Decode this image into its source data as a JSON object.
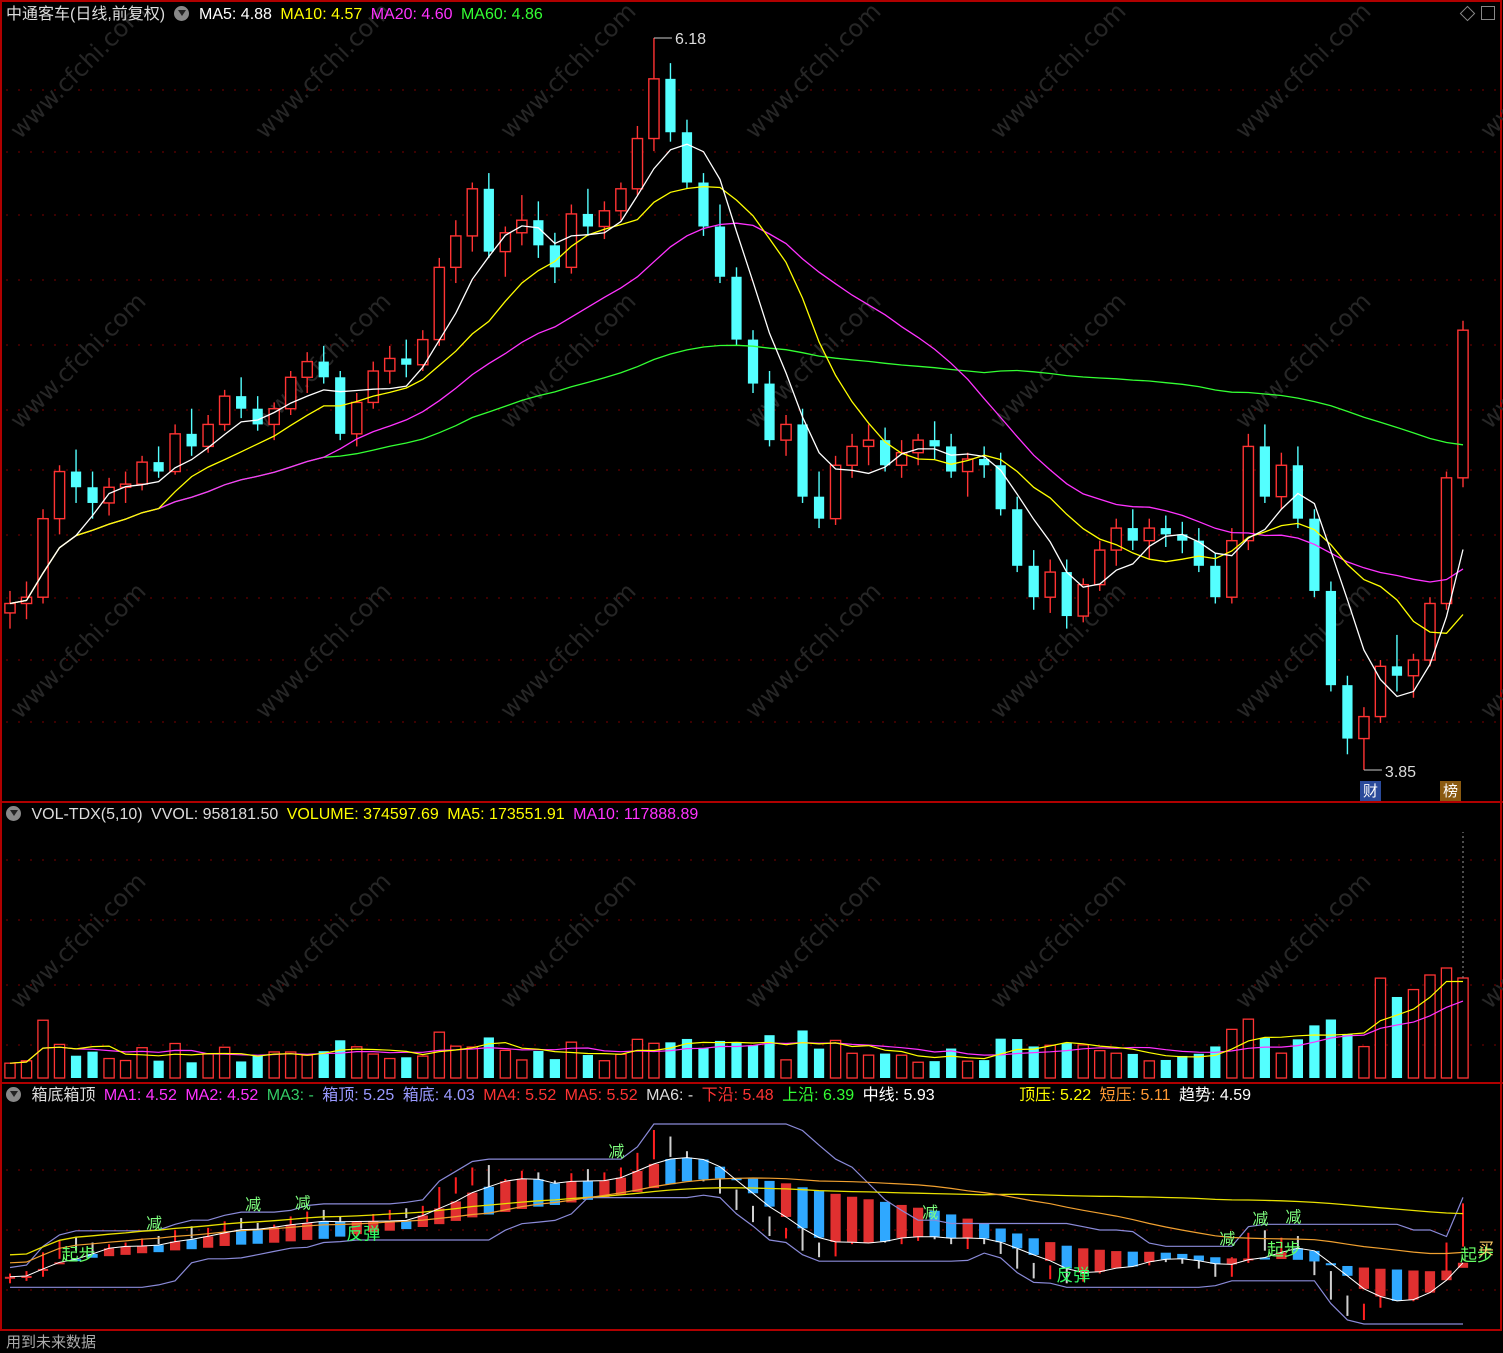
{
  "main_panel": {
    "title": "中通客车(日线,前复权)",
    "indicators": [
      {
        "label": "MA5: 4.88",
        "color": "#ffffff"
      },
      {
        "label": "MA10: 4.57",
        "color": "#ffff00"
      },
      {
        "label": "MA20: 4.60",
        "color": "#ff33ff"
      },
      {
        "label": "MA60: 4.86",
        "color": "#33ff33"
      }
    ],
    "high_label": "6.18",
    "low_label": "3.85",
    "tag_cai": "财",
    "tag_bang": "榜"
  },
  "vol_panel": {
    "title": "VOL-TDX(5,10)",
    "indicators": [
      {
        "label": "VVOL: 958181.50",
        "color": "#dddddd"
      },
      {
        "label": "VOLUME: 374597.69",
        "color": "#ffff00"
      },
      {
        "label": "MA5: 173551.91",
        "color": "#ffff00"
      },
      {
        "label": "MA10: 117888.89",
        "color": "#ff33ff"
      }
    ]
  },
  "box_panel": {
    "title": "箱底箱顶",
    "indicators": [
      {
        "label": "MA1: 4.52",
        "color": "#ff33ff"
      },
      {
        "label": "MA2: 4.52",
        "color": "#ff33ff"
      },
      {
        "label": "MA3: -",
        "color": "#33cc66"
      },
      {
        "label": "箱顶: 5.25",
        "color": "#9999ff"
      },
      {
        "label": "箱底: 4.03",
        "color": "#9999ff"
      },
      {
        "label": "MA4: 5.52",
        "color": "#ff3333"
      },
      {
        "label": "MA5: 5.52",
        "color": "#ff3333"
      },
      {
        "label": "MA6: -",
        "color": "#dddddd"
      },
      {
        "label": "下沿: 5.48",
        "color": "#ff3333"
      },
      {
        "label": "上沿: 6.39",
        "color": "#33ff33"
      },
      {
        "label": "中线: 5.93",
        "color": "#ffffff"
      },
      {
        "label": "顶压: 5.22",
        "color": "#ffff00"
      },
      {
        "label": "短压: 5.11",
        "color": "#ff9933"
      },
      {
        "label": "趋势: 4.59",
        "color": "#ffffff"
      }
    ],
    "signals": {
      "jian": "减",
      "fantan": "反弹",
      "qibu": "起步",
      "mai": "买"
    }
  },
  "footer": "用到未来数据",
  "watermark": "www.cfchi.com",
  "colors": {
    "up": "#ff3333",
    "down": "#54ffff",
    "ma5": "#ffffff",
    "ma10": "#ffff00",
    "ma20": "#ff33ff",
    "ma60": "#33ff33",
    "frame": "#b00000"
  },
  "chart_data": [
    {
      "type": "candlestick",
      "title": "中通客车(日线,前复权)",
      "y_range": [
        3.85,
        6.18
      ],
      "candles_ohlc": [
        [
          4.35,
          4.42,
          4.3,
          4.38
        ],
        [
          4.38,
          4.45,
          4.33,
          4.4
        ],
        [
          4.4,
          4.68,
          4.38,
          4.65
        ],
        [
          4.65,
          4.82,
          4.6,
          4.8
        ],
        [
          4.8,
          4.87,
          4.7,
          4.75
        ],
        [
          4.75,
          4.8,
          4.65,
          4.7
        ],
        [
          4.7,
          4.78,
          4.66,
          4.75
        ],
        [
          4.75,
          4.8,
          4.7,
          4.76
        ],
        [
          4.76,
          4.85,
          4.74,
          4.83
        ],
        [
          4.83,
          4.88,
          4.78,
          4.8
        ],
        [
          4.8,
          4.95,
          4.79,
          4.92
        ],
        [
          4.92,
          5.0,
          4.85,
          4.88
        ],
        [
          4.88,
          4.98,
          4.86,
          4.95
        ],
        [
          4.95,
          5.06,
          4.93,
          5.04
        ],
        [
          5.04,
          5.1,
          4.97,
          5.0
        ],
        [
          5.0,
          5.04,
          4.93,
          4.95
        ],
        [
          4.95,
          5.02,
          4.9,
          5.0
        ],
        [
          5.0,
          5.12,
          4.98,
          5.1
        ],
        [
          5.1,
          5.18,
          5.05,
          5.15
        ],
        [
          5.15,
          5.2,
          5.08,
          5.1
        ],
        [
          5.1,
          5.12,
          4.9,
          4.92
        ],
        [
          4.92,
          5.05,
          4.88,
          5.02
        ],
        [
          5.02,
          5.15,
          5.0,
          5.12
        ],
        [
          5.12,
          5.2,
          5.08,
          5.16
        ],
        [
          5.16,
          5.22,
          5.1,
          5.14
        ],
        [
          5.14,
          5.25,
          5.12,
          5.22
        ],
        [
          5.22,
          5.48,
          5.2,
          5.45
        ],
        [
          5.45,
          5.6,
          5.4,
          5.55
        ],
        [
          5.55,
          5.72,
          5.5,
          5.7
        ],
        [
          5.7,
          5.75,
          5.48,
          5.5
        ],
        [
          5.5,
          5.58,
          5.42,
          5.56
        ],
        [
          5.56,
          5.68,
          5.52,
          5.6
        ],
        [
          5.6,
          5.66,
          5.48,
          5.52
        ],
        [
          5.52,
          5.56,
          5.4,
          5.45
        ],
        [
          5.45,
          5.65,
          5.43,
          5.62
        ],
        [
          5.62,
          5.7,
          5.55,
          5.58
        ],
        [
          5.58,
          5.66,
          5.54,
          5.63
        ],
        [
          5.63,
          5.72,
          5.6,
          5.7
        ],
        [
          5.7,
          5.9,
          5.68,
          5.86
        ],
        [
          5.86,
          6.18,
          5.82,
          6.05
        ],
        [
          6.05,
          6.1,
          5.85,
          5.88
        ],
        [
          5.88,
          5.92,
          5.7,
          5.72
        ],
        [
          5.72,
          5.75,
          5.55,
          5.58
        ],
        [
          5.58,
          5.65,
          5.4,
          5.42
        ],
        [
          5.42,
          5.45,
          5.2,
          5.22
        ],
        [
          5.22,
          5.25,
          5.05,
          5.08
        ],
        [
          5.08,
          5.12,
          4.88,
          4.9
        ],
        [
          4.9,
          4.98,
          4.85,
          4.95
        ],
        [
          4.95,
          5.0,
          4.7,
          4.72
        ],
        [
          4.72,
          4.8,
          4.62,
          4.65
        ],
        [
          4.65,
          4.85,
          4.63,
          4.82
        ],
        [
          4.82,
          4.92,
          4.78,
          4.88
        ],
        [
          4.88,
          4.95,
          4.82,
          4.9
        ],
        [
          4.9,
          4.94,
          4.8,
          4.82
        ],
        [
          4.82,
          4.9,
          4.78,
          4.86
        ],
        [
          4.86,
          4.92,
          4.82,
          4.9
        ],
        [
          4.9,
          4.96,
          4.84,
          4.88
        ],
        [
          4.88,
          4.92,
          4.78,
          4.8
        ],
        [
          4.8,
          4.86,
          4.72,
          4.84
        ],
        [
          4.84,
          4.88,
          4.78,
          4.82
        ],
        [
          4.82,
          4.86,
          4.66,
          4.68
        ],
        [
          4.68,
          4.72,
          4.48,
          4.5
        ],
        [
          4.5,
          4.55,
          4.36,
          4.4
        ],
        [
          4.4,
          4.52,
          4.35,
          4.48
        ],
        [
          4.48,
          4.52,
          4.3,
          4.34
        ],
        [
          4.34,
          4.46,
          4.32,
          4.44
        ],
        [
          4.44,
          4.58,
          4.42,
          4.55
        ],
        [
          4.55,
          4.65,
          4.5,
          4.62
        ],
        [
          4.62,
          4.68,
          4.55,
          4.58
        ],
        [
          4.58,
          4.65,
          4.52,
          4.62
        ],
        [
          4.62,
          4.66,
          4.56,
          4.6
        ],
        [
          4.6,
          4.64,
          4.54,
          4.58
        ],
        [
          4.58,
          4.62,
          4.48,
          4.5
        ],
        [
          4.5,
          4.54,
          4.38,
          4.4
        ],
        [
          4.4,
          4.62,
          4.38,
          4.58
        ],
        [
          4.58,
          4.92,
          4.55,
          4.88
        ],
        [
          4.88,
          4.95,
          4.7,
          4.72
        ],
        [
          4.72,
          4.86,
          4.68,
          4.82
        ],
        [
          4.82,
          4.88,
          4.62,
          4.65
        ],
        [
          4.65,
          4.68,
          4.4,
          4.42
        ],
        [
          4.42,
          4.45,
          4.1,
          4.12
        ],
        [
          4.12,
          4.15,
          3.9,
          3.95
        ],
        [
          3.95,
          4.05,
          3.85,
          4.02
        ],
        [
          4.02,
          4.2,
          4.0,
          4.18
        ],
        [
          4.18,
          4.28,
          4.1,
          4.15
        ],
        [
          4.15,
          4.22,
          4.08,
          4.2
        ],
        [
          4.2,
          4.4,
          4.18,
          4.38
        ],
        [
          4.38,
          4.8,
          4.36,
          4.78
        ],
        [
          4.78,
          5.28,
          4.75,
          5.25
        ]
      ],
      "series": [
        {
          "name": "MA5",
          "current": 4.88
        },
        {
          "name": "MA10",
          "current": 4.57
        },
        {
          "name": "MA20",
          "current": 4.6
        },
        {
          "name": "MA60",
          "current": 4.86
        }
      ],
      "annotations": [
        {
          "text": "6.18",
          "kind": "high"
        },
        {
          "text": "3.85",
          "kind": "low"
        }
      ]
    },
    {
      "type": "bar",
      "title": "VOL-TDX(5,10)",
      "series": [
        {
          "name": "VVOL",
          "current": 958181.5
        },
        {
          "name": "VOLUME",
          "current": 374597.69
        },
        {
          "name": "MA5",
          "current": 173551.91
        },
        {
          "name": "MA10",
          "current": 117888.89
        }
      ]
    },
    {
      "type": "line",
      "title": "箱底箱顶",
      "series": [
        {
          "name": "MA1",
          "current": 4.52
        },
        {
          "name": "MA2",
          "current": 4.52
        },
        {
          "name": "箱顶",
          "current": 5.25
        },
        {
          "name": "箱底",
          "current": 4.03
        },
        {
          "name": "MA4",
          "current": 5.52
        },
        {
          "name": "MA5",
          "current": 5.52
        },
        {
          "name": "下沿",
          "current": 5.48
        },
        {
          "name": "上沿",
          "current": 6.39
        },
        {
          "name": "中线",
          "current": 5.93
        },
        {
          "name": "顶压",
          "current": 5.22
        },
        {
          "name": "短压",
          "current": 5.11
        },
        {
          "name": "趋势",
          "current": 4.59
        }
      ]
    }
  ]
}
